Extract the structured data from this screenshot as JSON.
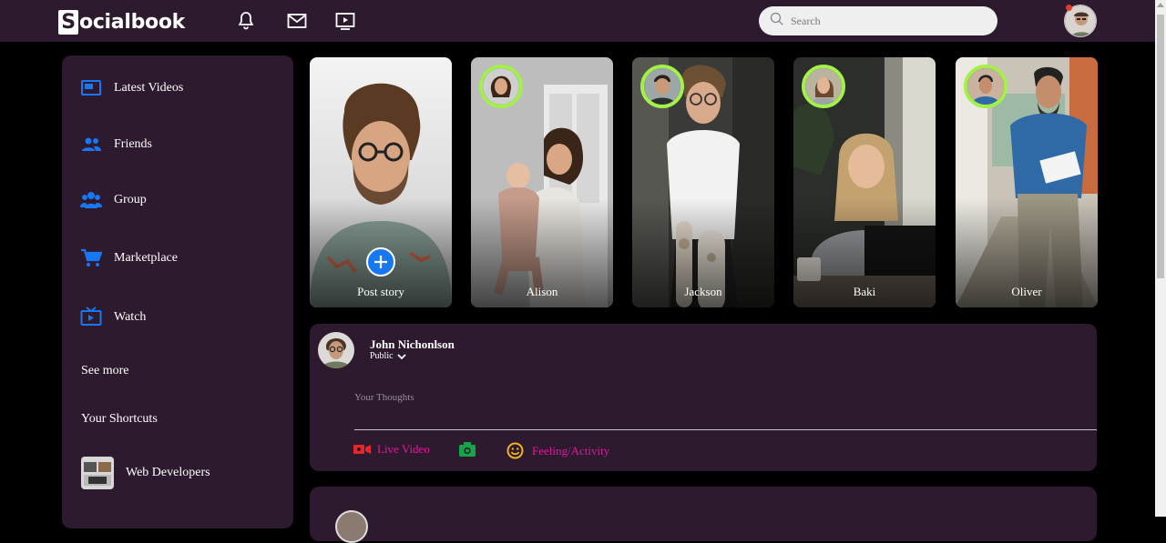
{
  "app": {
    "logo_letter": "S",
    "logo_rest": "ocialbook"
  },
  "header": {
    "icons": [
      "bell-icon",
      "mail-icon",
      "video-icon"
    ],
    "search_placeholder": "Search",
    "notification_color": "#e03a2f"
  },
  "sidebar": {
    "items": [
      {
        "label": "Latest Videos",
        "icon": "latest-videos-icon"
      },
      {
        "label": "Friends",
        "icon": "friends-icon"
      },
      {
        "label": "Group",
        "icon": "group-icon"
      },
      {
        "label": "Marketplace",
        "icon": "cart-icon"
      },
      {
        "label": "Watch",
        "icon": "tv-icon"
      }
    ],
    "see_more": "See more",
    "shortcuts_title": "Your Shortcuts",
    "shortcuts": [
      {
        "label": "Web Developers"
      }
    ]
  },
  "stories": [
    {
      "name": "Post story"
    },
    {
      "name": "Alison"
    },
    {
      "name": "Jackson"
    },
    {
      "name": "Baki"
    },
    {
      "name": "Oliver"
    }
  ],
  "composer": {
    "user_name": "John Nichonlson",
    "privacy": "Public",
    "placeholder": "Your Thoughts",
    "actions": [
      {
        "label": "Live Video",
        "icon": "live-video-icon"
      },
      {
        "label": "",
        "icon": "camera-icon"
      },
      {
        "label": "Feeling/Activity",
        "icon": "smiley-icon"
      }
    ]
  },
  "colors": {
    "panel": "#2d1a2e",
    "accent_blue": "#1877f2",
    "story_ring": "#a3f04a",
    "action_text": "#e2189b"
  }
}
